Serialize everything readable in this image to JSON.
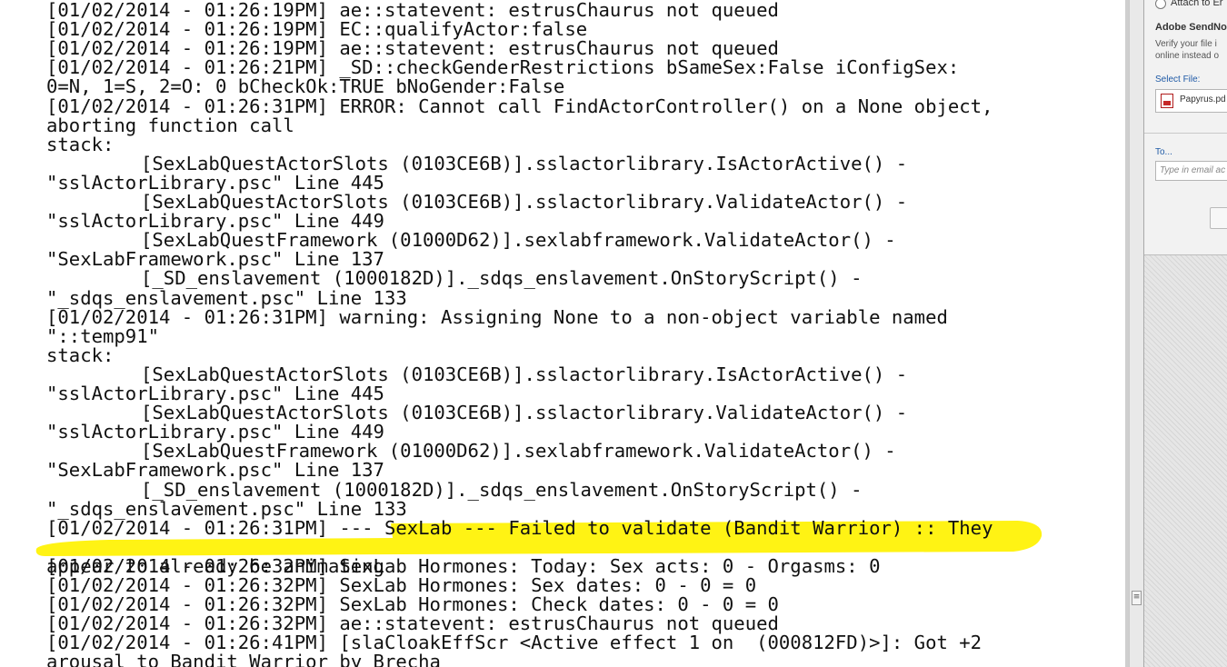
{
  "log": {
    "lines": [
      {
        "text": "[01/02/2014 - 01:26:19PM] ae::statevent: estrusChaurus not queued",
        "indent": false
      },
      {
        "text": "[01/02/2014 - 01:26:19PM] EC::qualifyActor:false",
        "indent": false
      },
      {
        "text": "[01/02/2014 - 01:26:19PM] ae::statevent: estrusChaurus not queued",
        "indent": false
      },
      {
        "text": "[01/02/2014 - 01:26:21PM] _SD::checkGenderRestrictions bSameSex:False iConfigSex:",
        "indent": false
      },
      {
        "text": "0=N, 1=S, 2=O: 0 bCheckOk:TRUE bNoGender:False",
        "indent": false
      },
      {
        "text": "[01/02/2014 - 01:26:31PM] ERROR: Cannot call FindActorController() on a None object,",
        "indent": false
      },
      {
        "text": "aborting function call",
        "indent": false
      },
      {
        "text": "stack:",
        "indent": false
      },
      {
        "text": "[SexLabQuestActorSlots (0103CE6B)].sslactorlibrary.IsActorActive() -",
        "indent": true
      },
      {
        "text": "\"sslActorLibrary.psc\" Line 445",
        "indent": false
      },
      {
        "text": "[SexLabQuestActorSlots (0103CE6B)].sslactorlibrary.ValidateActor() -",
        "indent": true
      },
      {
        "text": "\"sslActorLibrary.psc\" Line 449",
        "indent": false
      },
      {
        "text": "[SexLabQuestFramework (01000D62)].sexlabframework.ValidateActor() -",
        "indent": true
      },
      {
        "text": "\"SexLabFramework.psc\" Line 137",
        "indent": false
      },
      {
        "text": "[_SD_enslavement (1000182D)]._sdqs_enslavement.OnStoryScript() -",
        "indent": true
      },
      {
        "text": "\"_sdqs_enslavement.psc\" Line 133",
        "indent": false
      },
      {
        "text": "[01/02/2014 - 01:26:31PM] warning: Assigning None to a non-object variable named",
        "indent": false
      },
      {
        "text": "\"::temp91\"",
        "indent": false
      },
      {
        "text": "stack:",
        "indent": false
      },
      {
        "text": "[SexLabQuestActorSlots (0103CE6B)].sslactorlibrary.IsActorActive() -",
        "indent": true
      },
      {
        "text": "\"sslActorLibrary.psc\" Line 445",
        "indent": false
      },
      {
        "text": "[SexLabQuestActorSlots (0103CE6B)].sslactorlibrary.ValidateActor() -",
        "indent": true
      },
      {
        "text": "\"sslActorLibrary.psc\" Line 449",
        "indent": false
      },
      {
        "text": "[SexLabQuestFramework (01000D62)].sexlabframework.ValidateActor() -",
        "indent": true
      },
      {
        "text": "\"SexLabFramework.psc\" Line 137",
        "indent": false
      },
      {
        "text": "[_SD_enslavement (1000182D)]._sdqs_enslavement.OnStoryScript() -",
        "indent": true
      },
      {
        "text": "\"_sdqs_enslavement.psc\" Line 133",
        "indent": false
      },
      {
        "text": "[01/02/2014 - 01:26:31PM] --- SexLab --- Failed to validate (Bandit Warrior) :: They",
        "indent": false,
        "highlighted": true
      },
      {
        "text": "appear to already be animating",
        "indent": false,
        "highlighted": true
      },
      {
        "text": "[01/02/2014 - 01:26:32PM] SexLab Hormones: Today: Sex acts: 0 - Orgasms: 0",
        "indent": false
      },
      {
        "text": "[01/02/2014 - 01:26:32PM] SexLab Hormones: Sex dates: 0 - 0 = 0",
        "indent": false
      },
      {
        "text": "[01/02/2014 - 01:26:32PM] SexLab Hormones: Check dates: 0 - 0 = 0",
        "indent": false
      },
      {
        "text": "[01/02/2014 - 01:26:32PM] ae::statevent: estrusChaurus not queued",
        "indent": false
      },
      {
        "text": "[01/02/2014 - 01:26:41PM] [slaCloakEffScr <Active effect 1 on  (000812FD)>]: Got +2",
        "indent": false
      },
      {
        "text": "arousal to Bandit Warrior by Brecha",
        "indent": false
      }
    ],
    "highlight_color": "#fff200"
  },
  "side_panel": {
    "attach_label": "Attach to Er",
    "send_now_title": "Adobe SendNo",
    "verify_text_1": "Verify your file i",
    "verify_text_2": "online instead o",
    "select_file_label": "Select File:",
    "file_name": "Papyrus.pd",
    "to_label": "To...",
    "to_placeholder": "Type in email ac"
  }
}
